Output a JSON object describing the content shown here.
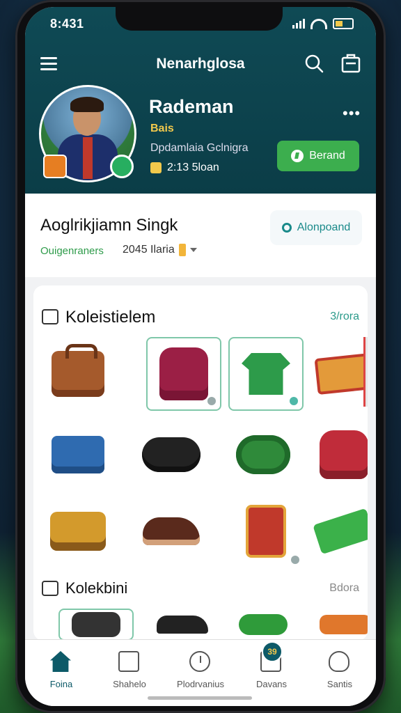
{
  "status": {
    "time": "8:431"
  },
  "header": {
    "app_title": "Nenarhglosa",
    "user_name": "Rademan",
    "user_tag": "Bais",
    "user_desc": "Dpdamlaia Gclnigra",
    "coins": "2:13 5loan",
    "cta_label": "Berand"
  },
  "info": {
    "title": "Aoglrikjiamn Singk",
    "subtitle": "Ouigenraners",
    "meta": "2045 Ilaria",
    "button_label": "Alonpoand"
  },
  "collection": {
    "section1_title": "Koleistielem",
    "section1_link": "3/rora",
    "section2_title": "Kolekbini",
    "section2_link": "Bdora"
  },
  "nav": {
    "items": [
      {
        "label": "Foina"
      },
      {
        "label": "Shahelo"
      },
      {
        "label": "Plodrvanius"
      },
      {
        "label": "Davans"
      },
      {
        "label": "Santis"
      }
    ],
    "badge": "39"
  },
  "colors": {
    "header": "#0f4a55",
    "accent": "#3cae4e",
    "nav_active": "#0d5a68"
  },
  "icons": [
    "menu-icon",
    "search-icon",
    "bag-icon",
    "more-icon",
    "gear-icon",
    "home-icon",
    "document-icon",
    "clock-icon",
    "chart-icon",
    "user-icon"
  ]
}
